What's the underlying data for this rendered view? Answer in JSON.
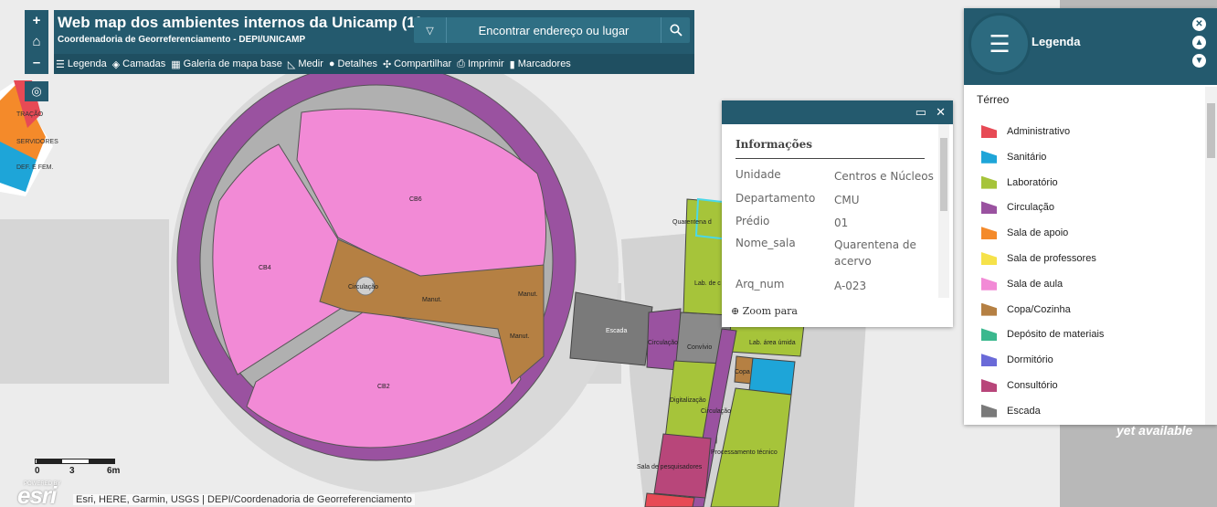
{
  "header": {
    "title": "Web map dos ambientes internos da Unicamp (1º e ...",
    "subtitle": "Coordenadoria de Georreferenciamento - DEPI/UNICAMP"
  },
  "search": {
    "placeholder": "Encontrar endereço ou lugar"
  },
  "toolbar": [
    {
      "label": "Legenda",
      "icon": "list-icon"
    },
    {
      "label": "Camadas",
      "icon": "layers-icon"
    },
    {
      "label": "Galeria de mapa base",
      "icon": "grid-icon"
    },
    {
      "label": "Medir",
      "icon": "ruler-icon"
    },
    {
      "label": "Detalhes",
      "icon": "info-icon"
    },
    {
      "label": "Compartilhar",
      "icon": "share-icon"
    },
    {
      "label": "Imprimir",
      "icon": "print-icon"
    },
    {
      "label": "Marcadores",
      "icon": "bookmark-icon"
    }
  ],
  "zoom": {
    "in": "+",
    "home": "⌂",
    "out": "–"
  },
  "popup": {
    "title": "Informações",
    "fields": [
      {
        "key": "Unidade",
        "value": "Centros e Núcleos"
      },
      {
        "key": "Departamento",
        "value": "CMU"
      },
      {
        "key": "Prédio",
        "value": "01"
      },
      {
        "key": "Nome_sala",
        "value": "Quarentena de acervo"
      },
      {
        "key": "Arq_num",
        "value": "A-023"
      }
    ],
    "footer": "Zoom para"
  },
  "legend": {
    "title": "Legenda",
    "section": "Térreo",
    "items": [
      {
        "label": "Administrativo",
        "color": "#e74a55"
      },
      {
        "label": "Sanitário",
        "color": "#1ea5d8"
      },
      {
        "label": "Laboratório",
        "color": "#a6c43a"
      },
      {
        "label": "Circulação",
        "color": "#9a52a0"
      },
      {
        "label": "Sala de apoio",
        "color": "#f48a2a"
      },
      {
        "label": "Sala de professores",
        "color": "#f6e24a"
      },
      {
        "label": "Sala de aula",
        "color": "#f28ad6"
      },
      {
        "label": "Copa/Cozinha",
        "color": "#b58043"
      },
      {
        "label": "Depósito de materiais",
        "color": "#3bb88e"
      },
      {
        "label": "Dormitório",
        "color": "#6a6ad8"
      },
      {
        "label": "Consultório",
        "color": "#b8467a"
      },
      {
        "label": "Escada",
        "color": "#7a7a7a"
      }
    ]
  },
  "map_labels": {
    "cb6": "CB6",
    "cb4": "CB4",
    "cb2": "CB2",
    "circulacao": "Circulação",
    "manut1": "Manut.",
    "manut2": "Manut.",
    "manut3": "Manut.",
    "escada": "Escada",
    "circulacao2": "Circulação",
    "convivio": "Convívio",
    "lab_umida": "Lab. área úmida",
    "copa": "Copa",
    "digitalizacao": "Digitalização",
    "circulacao3": "Circulação",
    "processamento": "Processamento técnico",
    "sala_pesq": "Sala de pesquisadores",
    "quarentena": "Quarentena d",
    "lab_de": "Lab. de c",
    "admin_partial": "TRAÇÃO",
    "servidores": "SERVIDORES",
    "def_fem": "DEF. E FEM."
  },
  "scale": {
    "zero": "0",
    "mid": "3",
    "end": "6m"
  },
  "attribution": "Esri, HERE, Garmin, USGS | DEPI/Coordenadoria de Georreferenciamento",
  "esri": {
    "logo": "esri",
    "powered": "POWERED BY"
  },
  "not_available": "yet available"
}
